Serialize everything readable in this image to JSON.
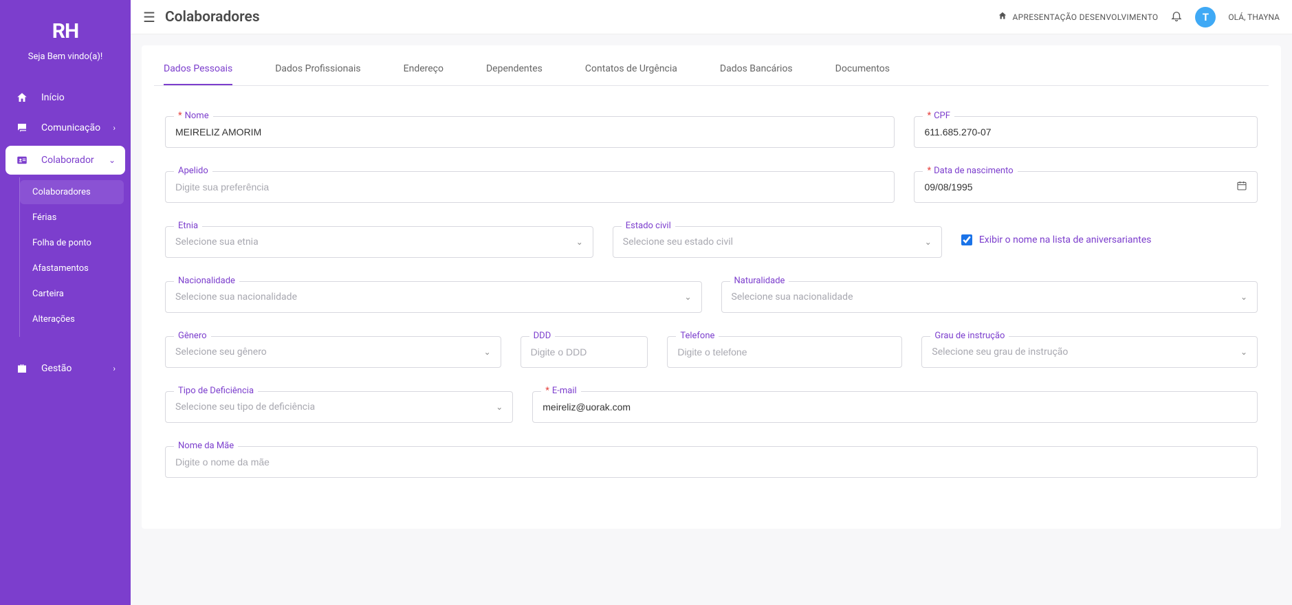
{
  "sidebar": {
    "logo": "RH",
    "welcome": "Seja Bem vindo(a)!",
    "items": [
      {
        "label": "Início",
        "icon": "home"
      },
      {
        "label": "Comunicação",
        "icon": "chat",
        "expandable": true
      },
      {
        "label": "Colaborador",
        "icon": "idcard",
        "expandable": true,
        "active": true,
        "children": [
          {
            "label": "Colaboradores",
            "selected": true
          },
          {
            "label": "Férias"
          },
          {
            "label": "Folha de ponto"
          },
          {
            "label": "Afastamentos"
          },
          {
            "label": "Carteira"
          },
          {
            "label": "Alterações"
          }
        ]
      },
      {
        "label": "Gestão",
        "icon": "briefcase",
        "expandable": true
      }
    ]
  },
  "header": {
    "page_title": "Colaboradores",
    "org": "APRESENTAÇÃO DESENVOLVIMENTO",
    "avatar_initial": "T",
    "hello": "OLÁ, THAYNA"
  },
  "tabs": [
    {
      "label": "Dados Pessoais",
      "active": true
    },
    {
      "label": "Dados Profissionais"
    },
    {
      "label": "Endereço"
    },
    {
      "label": "Dependentes"
    },
    {
      "label": "Contatos de Urgência"
    },
    {
      "label": "Dados Bancários"
    },
    {
      "label": "Documentos"
    }
  ],
  "form": {
    "nome": {
      "label": "Nome",
      "value": "MEIRELIZ AMORIM"
    },
    "cpf": {
      "label": "CPF",
      "value": "611.685.270-07"
    },
    "apelido": {
      "label": "Apelido",
      "placeholder": "Digite sua preferência"
    },
    "dob": {
      "label": "Data de nascimento",
      "value": "09/08/1995"
    },
    "etnia": {
      "label": "Etnia",
      "placeholder": "Selecione sua etnia"
    },
    "estcivil": {
      "label": "Estado civil",
      "placeholder": "Selecione seu estado civil"
    },
    "aniversariantes": {
      "label": "Exibir o nome na lista de aniversariantes",
      "checked": true
    },
    "nacionalidade": {
      "label": "Nacionalidade",
      "placeholder": "Selecione sua nacionalidade"
    },
    "naturalidade": {
      "label": "Naturalidade",
      "placeholder": "Selecione sua nacionalidade"
    },
    "genero": {
      "label": "Gênero",
      "placeholder": "Selecione seu gênero"
    },
    "ddd": {
      "label": "DDD",
      "placeholder": "Digite o DDD"
    },
    "telefone": {
      "label": "Telefone",
      "placeholder": "Digite o telefone"
    },
    "grau": {
      "label": "Grau de instrução",
      "placeholder": "Selecione seu grau de instrução"
    },
    "deficiencia": {
      "label": "Tipo de Deficiência",
      "placeholder": "Selecione seu tipo de deficiência"
    },
    "email": {
      "label": "E-mail",
      "value": "meireliz@uorak.com"
    },
    "mae": {
      "label": "Nome da Mãe",
      "placeholder": "Digite o nome da mãe"
    }
  }
}
